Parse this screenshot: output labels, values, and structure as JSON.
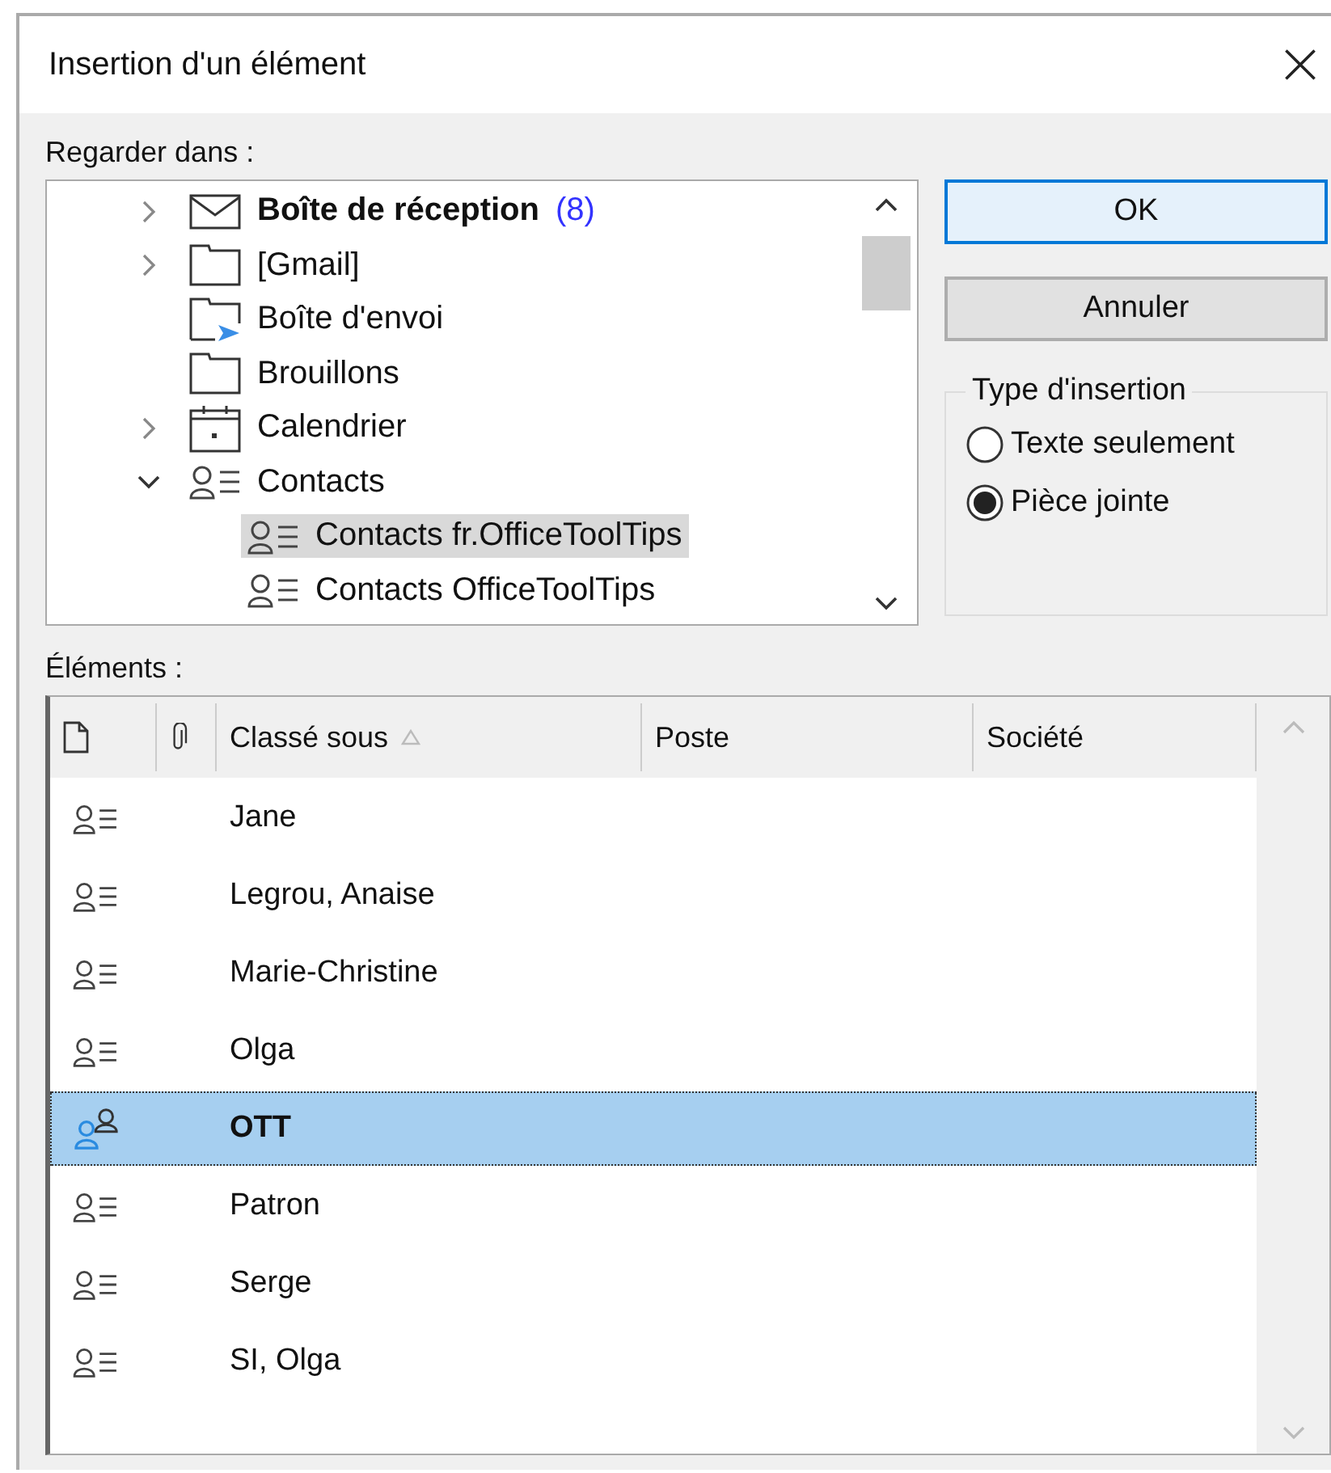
{
  "window": {
    "title": "Insertion d'un élément"
  },
  "look_in": {
    "label": "Regarder dans :",
    "folders": [
      {
        "label": "Boîte de réception",
        "kind": "inbox",
        "count": "(8)",
        "unread": true,
        "expandable": true,
        "expanded": false,
        "selected": false
      },
      {
        "label": "[Gmail]",
        "kind": "folder",
        "unread": false,
        "expandable": true,
        "expanded": false,
        "selected": false
      },
      {
        "label": "Boîte d'envoi",
        "kind": "outbox",
        "unread": false,
        "expandable": false,
        "expanded": false,
        "selected": false
      },
      {
        "label": "Brouillons",
        "kind": "folder",
        "unread": false,
        "expandable": false,
        "expanded": false,
        "selected": false
      },
      {
        "label": "Calendrier",
        "kind": "calendar",
        "unread": false,
        "expandable": true,
        "expanded": false,
        "selected": false
      },
      {
        "label": "Contacts",
        "kind": "contacts",
        "unread": false,
        "expandable": true,
        "expanded": true,
        "selected": false,
        "children": [
          {
            "label": "Contacts fr.OfficeToolTips",
            "kind": "contacts",
            "unread": false,
            "expandable": false,
            "expanded": false,
            "selected": true
          },
          {
            "label": "Contacts OfficeToolTips",
            "kind": "contacts",
            "unread": false,
            "expandable": false,
            "expanded": false,
            "selected": false
          }
        ]
      }
    ]
  },
  "buttons": [
    {
      "label": "OK",
      "default": true
    },
    {
      "label": "Annuler",
      "default": false
    }
  ],
  "insert_type": {
    "title": "Type d'insertion",
    "options": [
      {
        "label": "Texte seulement",
        "selected": false
      },
      {
        "label": "Pièce jointe",
        "selected": true
      }
    ]
  },
  "items": {
    "label": "Éléments :",
    "columns": [
      {
        "kind": "icon"
      },
      {
        "kind": "attachment"
      },
      {
        "kind": "text",
        "label": "Classé sous",
        "sorted": true
      },
      {
        "kind": "text",
        "label": "Poste",
        "sorted": false
      },
      {
        "kind": "text",
        "label": "Société",
        "sorted": false
      }
    ],
    "rows": [
      {
        "kind": "contact",
        "name": "Jane",
        "selected": false
      },
      {
        "kind": "contact",
        "name": "Legrou, Anaise",
        "selected": false
      },
      {
        "kind": "contact",
        "name": "Marie-Christine",
        "selected": false
      },
      {
        "kind": "contact",
        "name": "Olga",
        "selected": false
      },
      {
        "kind": "group",
        "name": "OTT",
        "selected": true
      },
      {
        "kind": "contact",
        "name": "Patron",
        "selected": false
      },
      {
        "kind": "contact",
        "name": "Serge",
        "selected": false
      },
      {
        "kind": "contact",
        "name": "SI, Olga",
        "selected": false
      }
    ]
  }
}
